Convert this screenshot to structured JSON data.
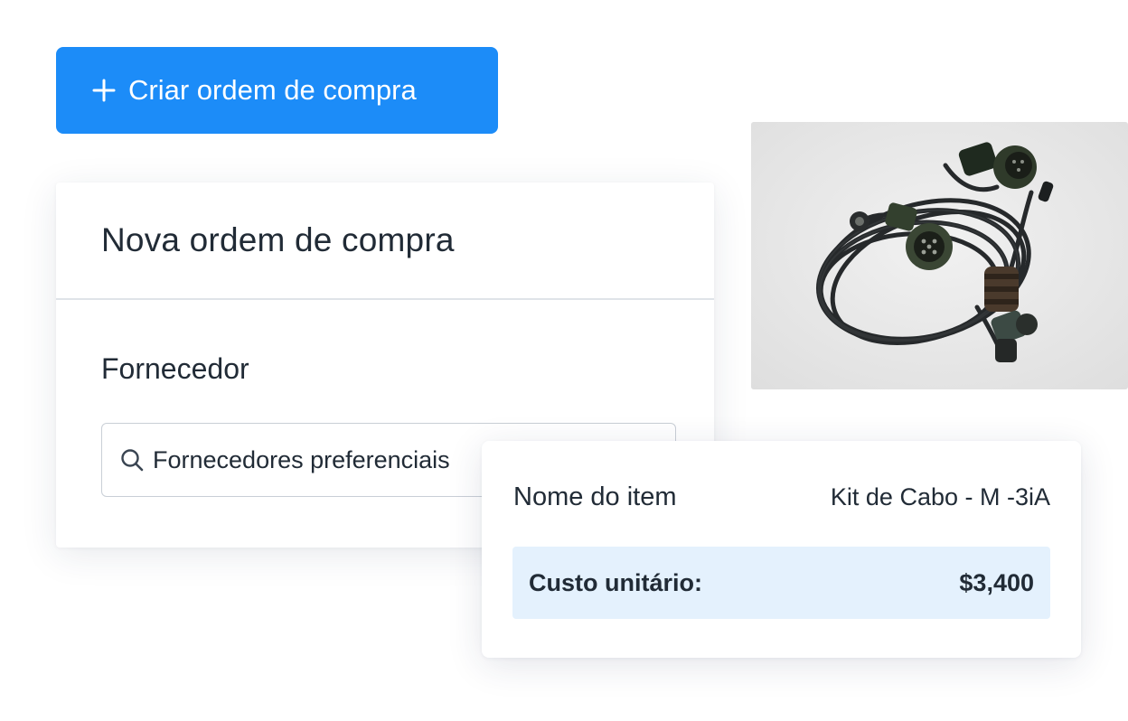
{
  "create_button": {
    "label": "Criar ordem de compra",
    "icon": "plus-icon",
    "color": "#1c8cf8"
  },
  "po_form": {
    "title": "Nova ordem de compra",
    "supplier_label": "Fornecedor",
    "supplier_search": {
      "placeholder": "Fornecedores preferenciais",
      "value": "",
      "icon": "search-icon"
    }
  },
  "product_photo": {
    "subject": "cable-kit-photo"
  },
  "item_card": {
    "name_label": "Nome do item",
    "name_value": "Kit de Cabo - M -3iA",
    "cost_label": "Custo unitário:",
    "cost_value": "$3,400",
    "cost_highlight_color": "#e4f1fd"
  }
}
